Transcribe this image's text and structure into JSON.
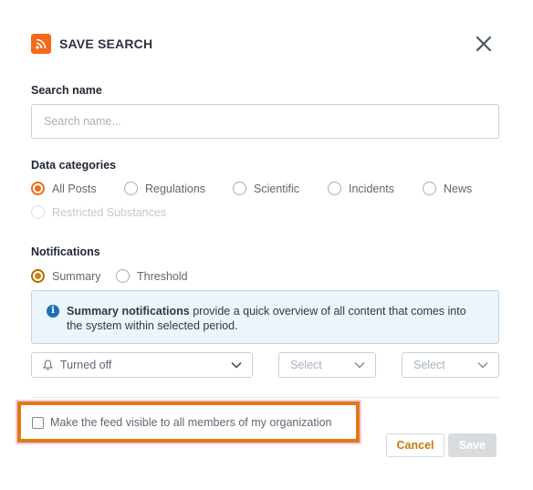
{
  "dialog": {
    "title": "SAVE SEARCH",
    "icon": "rss-icon",
    "close_icon": "close-icon"
  },
  "search_name": {
    "label": "Search name",
    "placeholder": "Search name...",
    "value": ""
  },
  "data_categories": {
    "label": "Data categories",
    "options": [
      {
        "label": "All Posts",
        "checked": true,
        "disabled": false
      },
      {
        "label": "Regulations",
        "checked": false,
        "disabled": false
      },
      {
        "label": "Scientific",
        "checked": false,
        "disabled": false
      },
      {
        "label": "Incidents",
        "checked": false,
        "disabled": false
      },
      {
        "label": "News",
        "checked": false,
        "disabled": false
      },
      {
        "label": "Restricted Substances",
        "checked": false,
        "disabled": true
      }
    ]
  },
  "notifications": {
    "label": "Notifications",
    "options": [
      {
        "label": "Summary",
        "checked": true
      },
      {
        "label": "Threshold",
        "checked": false
      }
    ],
    "info": {
      "bold": "Summary notifications",
      "text": " provide a quick overview of all content that comes into the system within selected period."
    },
    "selects": [
      {
        "value": "Turned off",
        "icon": "bell-icon"
      },
      {
        "value": "Select"
      },
      {
        "value": "Select"
      }
    ]
  },
  "visibility": {
    "label": "Make the feed visible to all members of my organization",
    "checked": false
  },
  "buttons": {
    "cancel": "Cancel",
    "save": "Save"
  },
  "colors": {
    "accent": "#f26a1b",
    "highlight_border": "#e07a10",
    "info_background": "#edf5fc",
    "info_icon": "#1d6fb8"
  }
}
